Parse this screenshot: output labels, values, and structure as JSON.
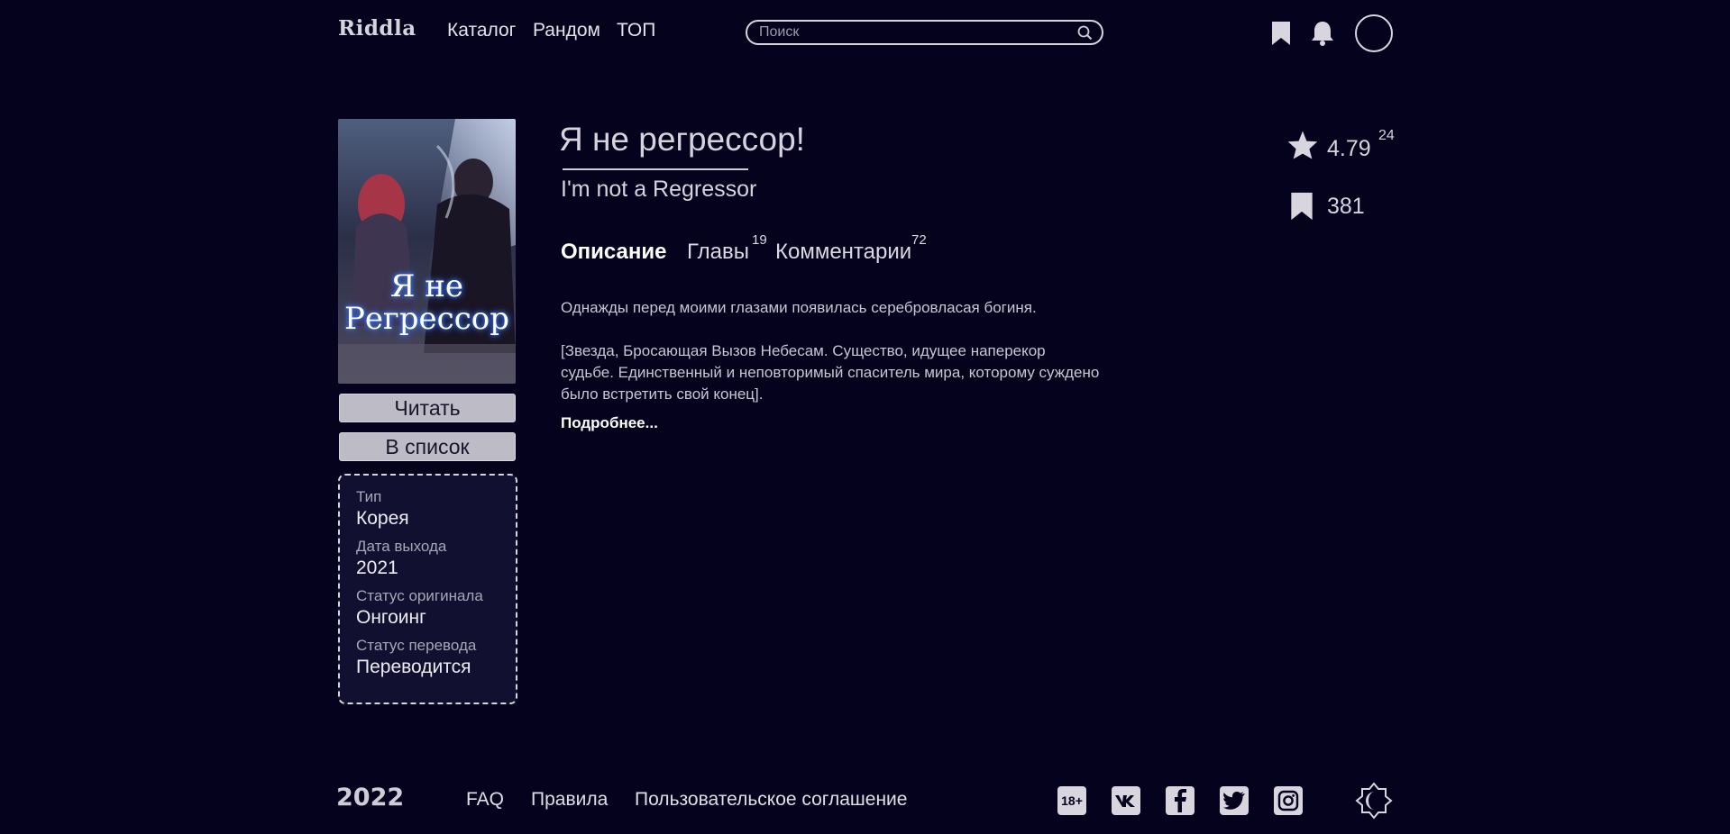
{
  "header": {
    "logo": "Riddla",
    "nav": [
      "Каталог",
      "Рандом",
      "ТОП"
    ],
    "search_placeholder": "Поиск"
  },
  "cover": {
    "title_line1": "Я не",
    "title_line2": "Регрессор"
  },
  "buttons": {
    "read": "Читать",
    "add_to_list": "В список"
  },
  "info": [
    {
      "label": "Тип",
      "value": "Корея"
    },
    {
      "label": "Дата выхода",
      "value": "2021"
    },
    {
      "label": "Статус оригинала",
      "value": "Онгоинг"
    },
    {
      "label": "Статус перевода",
      "value": "Переводится"
    }
  ],
  "title": {
    "main": "Я не регрессор!",
    "original": "I'm not a Regressor"
  },
  "tabs": [
    {
      "label": "Описание",
      "count": ""
    },
    {
      "label": "Главы",
      "count": "19"
    },
    {
      "label": "Комментарии",
      "count": "72"
    }
  ],
  "description": {
    "paragraph1": "Однажды перед моими глазами появилась серебровласая богиня.",
    "paragraph2": "[Звезда, Бросающая Вызов Небесам. Существо, идущее наперекор судьбе. Единственный и неповторимый спаситель мира, которому суждено было встретить свой конец].",
    "more": "Подробнее..."
  },
  "stats": {
    "rating": "4.79",
    "rating_votes": "24",
    "bookmarks": "381"
  },
  "footer": {
    "year": "2022",
    "links": [
      "FAQ",
      "Правила",
      "Пользовательское соглашение"
    ],
    "age_badge": "18+"
  },
  "colors": {
    "background": "#04021d",
    "text": "#ece9f2",
    "button": "#bdbcc6",
    "info_box": "#111030"
  }
}
